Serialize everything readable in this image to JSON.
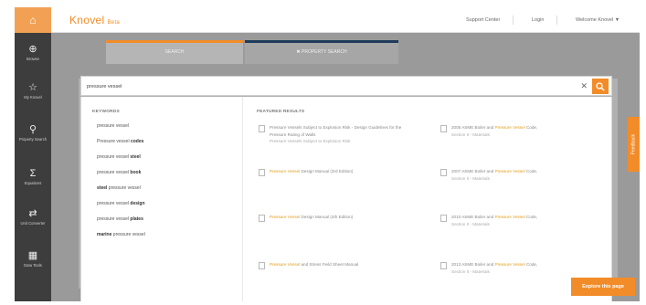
{
  "app": {
    "brand": "Knovel",
    "brand_tag": "Beta",
    "top_links": [
      "Support Center",
      "Login",
      "Welcome Knovel ▼"
    ]
  },
  "sidebar": {
    "items": [
      {
        "icon": "browse-icon",
        "label": "Browse"
      },
      {
        "icon": "star-icon",
        "label": "My Knovel"
      },
      {
        "icon": "property-search-icon",
        "label": "Property Search"
      },
      {
        "icon": "sigma-icon",
        "label": "Equations"
      },
      {
        "icon": "converter-icon",
        "label": "Unit Converter"
      },
      {
        "icon": "tools-icon",
        "label": "Data Tools"
      }
    ]
  },
  "tabs": [
    {
      "label": "SEARCH",
      "accent": "#f28c28"
    },
    {
      "label": "✖ PROPERTY SEARCH",
      "accent": "#1f3c5a"
    }
  ],
  "search": {
    "value": "pressure vessel",
    "placeholder": ""
  },
  "dropdown": {
    "keywords_heading": "KEYWORDS",
    "keywords": [
      {
        "pre": "pressure vessel",
        "bold": ""
      },
      {
        "pre": "Pressure vessel ",
        "bold": "codes"
      },
      {
        "pre": "pressure vessel ",
        "bold": "steel"
      },
      {
        "pre": "pressure vessel ",
        "bold": "book"
      },
      {
        "pre": "",
        "bold": "steel",
        "post": " pressure vessel"
      },
      {
        "pre": "pressure vessel ",
        "bold": "design"
      },
      {
        "pre": "pressure vessel ",
        "bold": "plates"
      },
      {
        "pre": "",
        "bold": "marine",
        "post": " pressure vessel"
      }
    ],
    "featured_heading": "FEATURED RESULTS",
    "featured_left": [
      {
        "text": "Pressure Vessels Subject to Explosion Risk - Design Guidelines for the Pressure Rating of Walls",
        "sub": "Pressure Vessels Subject to Explosion Risk"
      },
      {
        "hl": "Pressure Vessel",
        "text": " Design Manual (3rd Edition)",
        "sub": ""
      },
      {
        "hl": "Pressure Vessel",
        "text": " Design Manual (4th Edition)",
        "sub": ""
      },
      {
        "hl": "Pressure Vessel",
        "text": " and Stress Field Sheet Manual",
        "sub": ""
      }
    ],
    "featured_right": [
      {
        "pre": "2005 ASME Boiler and ",
        "hl": "Pressure Vessel",
        "post": " Code,",
        "sub": "Section II - Materials"
      },
      {
        "pre": "2007 ASME Boiler and ",
        "hl": "Pressure Vessel",
        "post": " Code,",
        "sub": "Section II - Materials"
      },
      {
        "pre": "2010 ASME Boiler and ",
        "hl": "Pressure Vessel",
        "post": " Code,",
        "sub": "Section II - Materials"
      },
      {
        "pre": "2013 ASME Boiler and ",
        "hl": "Pressure Vessel",
        "post": " Code,",
        "sub": "Section II - Materials"
      }
    ]
  },
  "feedback_label": "Feedback",
  "explore_label": "Explore this page",
  "colors": {
    "accent": "#f28c28",
    "sidebar": "#3d3d3d",
    "highlight": "#e0a020"
  }
}
